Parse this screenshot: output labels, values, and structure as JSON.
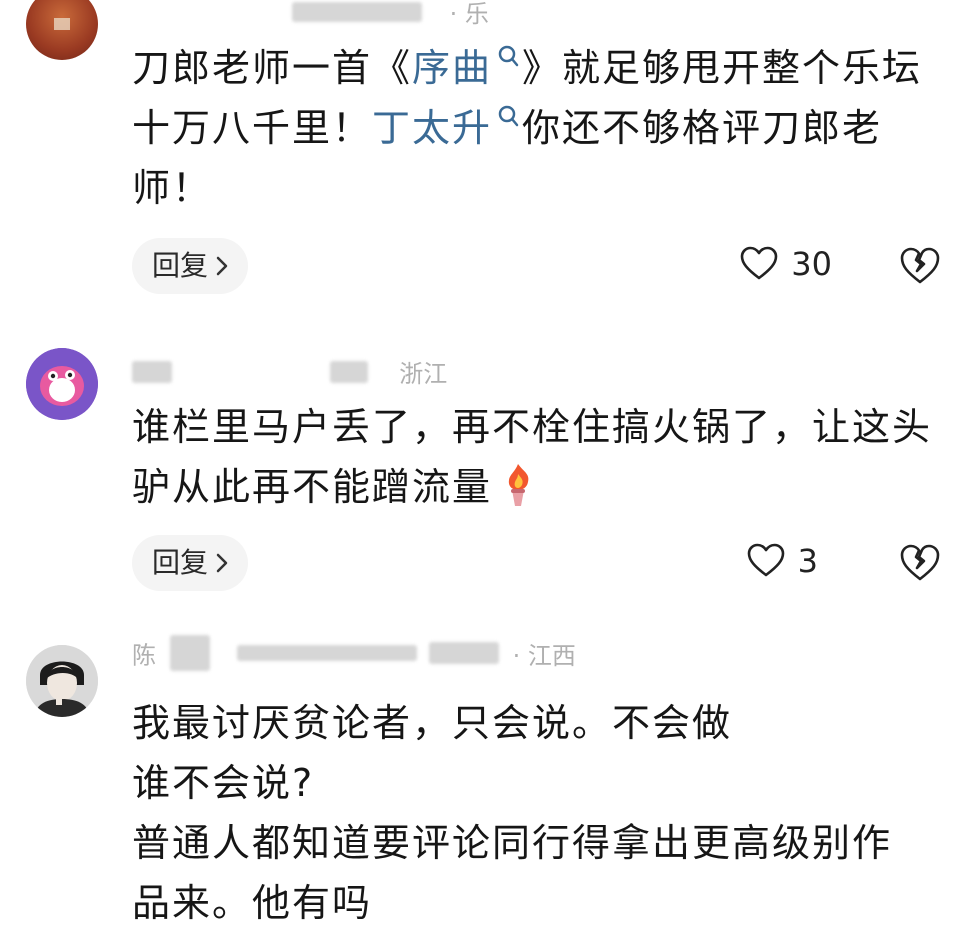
{
  "comments": [
    {
      "meta_tail": "· 乐",
      "segments": [
        {
          "text": "刀郎老师一首《",
          "link": false
        },
        {
          "text": "序曲",
          "link": true
        },
        {
          "text": "》就足够甩开整个乐坛十万八千里！",
          "link": false
        },
        {
          "text": "丁太升",
          "link": true
        },
        {
          "text": "你还不够格评刀郎老师！",
          "link": false
        }
      ],
      "reply_label": "回复",
      "likes": "30"
    },
    {
      "meta_tail": "浙江",
      "segments": [
        {
          "text": "谁栏里马户丢了，再不栓住搞火锅了，让这头驴从此再不能蹭流量",
          "link": false
        }
      ],
      "reply_label": "回复",
      "likes": "3"
    },
    {
      "meta_head": "陈",
      "meta_tail": "· 江西",
      "lines": [
        "我最讨厌贫论者，只会说。不会做",
        "谁不会说?",
        "普通人都知道要评论同行得拿出更高级别作",
        "品来。他有吗"
      ]
    }
  ],
  "colors": {
    "link": "#3a6a95",
    "reply_bg": "#f4f4f4",
    "meta": "#9a9a9a"
  },
  "icons": [
    "search-icon",
    "chevron-right-icon",
    "heart-outline-icon",
    "broken-heart-icon",
    "torch-emoji-icon"
  ]
}
